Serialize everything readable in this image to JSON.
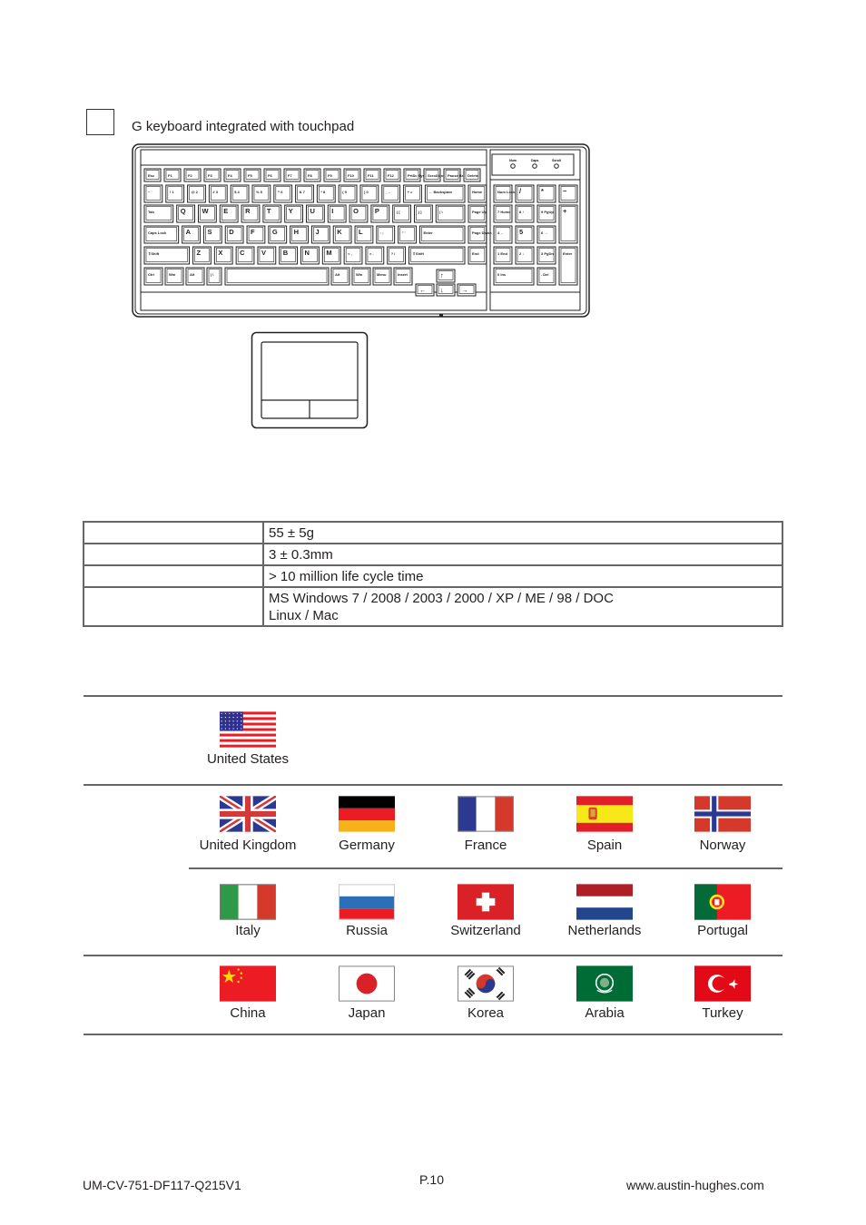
{
  "option": {
    "checkbox_checked": false,
    "caption": "G keyboard integrated with touchpad"
  },
  "keyboard": {
    "indicators": [
      "Num",
      "Caps",
      "Scroll"
    ],
    "rows": [
      [
        "Esc",
        "F1",
        "F2",
        "F3",
        "F4",
        "F5",
        "F6",
        "F7",
        "F8",
        "F9",
        "F10",
        "F11",
        "F12",
        "PrtSc SysRq",
        "Scroll Lock",
        "Pause Break",
        "Delete"
      ],
      [
        "~ `",
        "! 1",
        "@ 2",
        "# 3",
        "$ 4",
        "% 5",
        "^ 6",
        "& 7",
        "* 8",
        "( 9",
        ") 0",
        "_ -",
        "+ =",
        "← Backspace",
        "Home"
      ],
      [
        "Tab",
        "Q",
        "W",
        "E",
        "R",
        "T",
        "Y",
        "U",
        "I",
        "O",
        "P",
        "{ [",
        "} ]",
        "| \\",
        "Page Up"
      ],
      [
        "Caps Lock",
        "A",
        "S",
        "D",
        "F",
        "G",
        "H",
        "J",
        "K",
        "L",
        ": ;",
        "\" '",
        "Enter",
        "Page Down"
      ],
      [
        "⇧Shift",
        "Z",
        "X",
        "C",
        "V",
        "B",
        "N",
        "M",
        "< ,",
        "> .",
        "? /",
        "⇧Shift",
        "End"
      ],
      [
        "Ctrl",
        "Win",
        "Alt",
        "| \\",
        "",
        "Alt",
        "Win",
        "Menu",
        "Insert",
        "↑",
        "←",
        "↓",
        "→"
      ]
    ],
    "numpad": [
      [
        "Num Lock",
        "/",
        "*",
        "−"
      ],
      [
        "7 Home",
        "8 ↑",
        "9 PgUp",
        "+"
      ],
      [
        "4 ←",
        "5",
        "6 →"
      ],
      [
        "1 End",
        "2 ↓",
        "3 PgDn",
        "Enter"
      ],
      [
        "0 Ins",
        ". Del"
      ]
    ]
  },
  "specs": {
    "rows": [
      {
        "label": "",
        "value": "55 ± 5g"
      },
      {
        "label": "",
        "value": "3 ± 0.3mm"
      },
      {
        "label": "",
        "value": "> 10 million life cycle time"
      },
      {
        "label": "",
        "value": "MS Windows 7 / 2008 / 2003 / 2000 / XP / ME / 98 / DOC",
        "value2": "Linux / Mac"
      }
    ]
  },
  "languages": {
    "groups": [
      {
        "flags": [
          {
            "name": "United States",
            "icon": "flag-us"
          }
        ]
      },
      {
        "flags": [
          {
            "name": "United Kingdom",
            "icon": "flag-uk"
          },
          {
            "name": "Germany",
            "icon": "flag-de"
          },
          {
            "name": "France",
            "icon": "flag-fr"
          },
          {
            "name": "Spain",
            "icon": "flag-es"
          },
          {
            "name": "Norway",
            "icon": "flag-no"
          },
          {
            "name": "Italy",
            "icon": "flag-it"
          },
          {
            "name": "Russia",
            "icon": "flag-ru"
          },
          {
            "name": "Switzerland",
            "icon": "flag-ch"
          },
          {
            "name": "Netherlands",
            "icon": "flag-nl"
          },
          {
            "name": "Portugal",
            "icon": "flag-pt"
          }
        ]
      },
      {
        "flags": [
          {
            "name": "China",
            "icon": "flag-cn"
          },
          {
            "name": "Japan",
            "icon": "flag-jp"
          },
          {
            "name": "Korea",
            "icon": "flag-kr"
          },
          {
            "name": "Arabia",
            "icon": "flag-arab"
          },
          {
            "name": "Turkey",
            "icon": "flag-tr"
          }
        ]
      }
    ]
  },
  "footer": {
    "doc_id": "UM-CV-751-DF117-Q215V1",
    "page": "P.10",
    "website": "www.austin-hughes.com"
  }
}
